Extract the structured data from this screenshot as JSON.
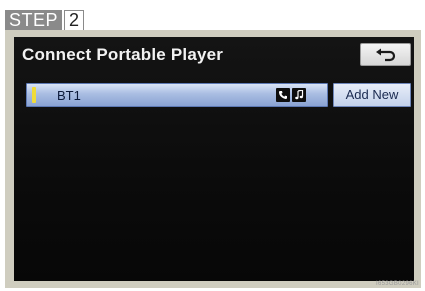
{
  "step": {
    "word": "STEP",
    "number": "2"
  },
  "screen": {
    "title": "Connect Portable Player",
    "back_icon": "back-arrow-icon",
    "device": {
      "name": "BT1",
      "indicator_color": "#f0dc3a",
      "icons": [
        "phone-icon",
        "music-note-icon"
      ]
    },
    "add_new_label": "Add New"
  },
  "watermark": "I653GB0296KI",
  "colors": {
    "row_blue": "#a9bde2",
    "screen_bg": "#0b0b0b",
    "frame": "#cfcdbf"
  }
}
